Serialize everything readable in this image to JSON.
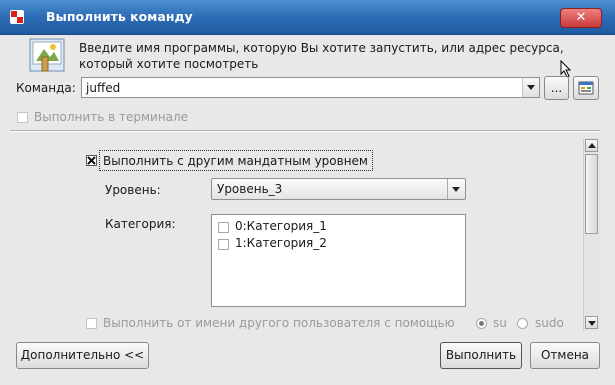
{
  "window": {
    "title": "Выполнить команду",
    "close_label": "✕"
  },
  "info": {
    "text": "Введите имя программы, которую Вы хотите запустить, или адрес ресурса, который хотите посмотреть"
  },
  "command": {
    "label": "Команда:",
    "value": "juffed",
    "browse_label": "..."
  },
  "terminal": {
    "label": "Выполнить в терминале",
    "checked": false
  },
  "mandatory": {
    "label": "Выполнить с другим мандатным уровнем",
    "checked": true,
    "level_label": "Уровень:",
    "level_value": "Уровень_3",
    "category_label": "Категория:",
    "categories": [
      {
        "label": "0:Категория_1",
        "checked": false
      },
      {
        "label": "1:Категория_2",
        "checked": false
      }
    ]
  },
  "other_user": {
    "label": "Выполнить от имени другого пользователя с помощью",
    "checked": false,
    "options": [
      "su",
      "sudo"
    ],
    "selected": "su"
  },
  "buttons": {
    "more": "Дополнительно <<",
    "run": "Выполнить",
    "cancel": "Отмена"
  },
  "colors": {
    "titlebar": "#2d6cb5",
    "close": "#c83a3a"
  }
}
